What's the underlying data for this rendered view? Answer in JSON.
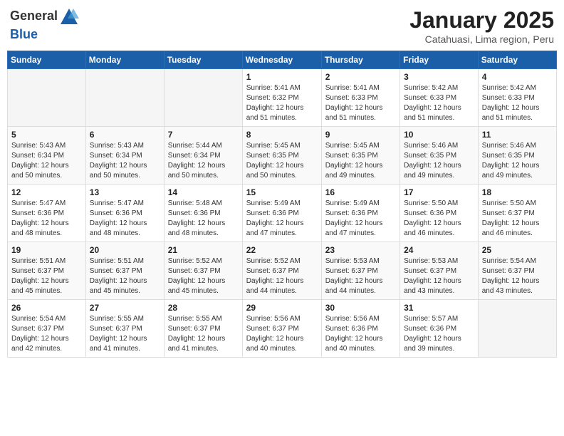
{
  "header": {
    "logo_general": "General",
    "logo_blue": "Blue",
    "month_title": "January 2025",
    "location": "Catahuasi, Lima region, Peru"
  },
  "days_of_week": [
    "Sunday",
    "Monday",
    "Tuesday",
    "Wednesday",
    "Thursday",
    "Friday",
    "Saturday"
  ],
  "weeks": [
    [
      {
        "day": "",
        "info": ""
      },
      {
        "day": "",
        "info": ""
      },
      {
        "day": "",
        "info": ""
      },
      {
        "day": "1",
        "info": "Sunrise: 5:41 AM\nSunset: 6:32 PM\nDaylight: 12 hours\nand 51 minutes."
      },
      {
        "day": "2",
        "info": "Sunrise: 5:41 AM\nSunset: 6:33 PM\nDaylight: 12 hours\nand 51 minutes."
      },
      {
        "day": "3",
        "info": "Sunrise: 5:42 AM\nSunset: 6:33 PM\nDaylight: 12 hours\nand 51 minutes."
      },
      {
        "day": "4",
        "info": "Sunrise: 5:42 AM\nSunset: 6:33 PM\nDaylight: 12 hours\nand 51 minutes."
      }
    ],
    [
      {
        "day": "5",
        "info": "Sunrise: 5:43 AM\nSunset: 6:34 PM\nDaylight: 12 hours\nand 50 minutes."
      },
      {
        "day": "6",
        "info": "Sunrise: 5:43 AM\nSunset: 6:34 PM\nDaylight: 12 hours\nand 50 minutes."
      },
      {
        "day": "7",
        "info": "Sunrise: 5:44 AM\nSunset: 6:34 PM\nDaylight: 12 hours\nand 50 minutes."
      },
      {
        "day": "8",
        "info": "Sunrise: 5:45 AM\nSunset: 6:35 PM\nDaylight: 12 hours\nand 50 minutes."
      },
      {
        "day": "9",
        "info": "Sunrise: 5:45 AM\nSunset: 6:35 PM\nDaylight: 12 hours\nand 49 minutes."
      },
      {
        "day": "10",
        "info": "Sunrise: 5:46 AM\nSunset: 6:35 PM\nDaylight: 12 hours\nand 49 minutes."
      },
      {
        "day": "11",
        "info": "Sunrise: 5:46 AM\nSunset: 6:35 PM\nDaylight: 12 hours\nand 49 minutes."
      }
    ],
    [
      {
        "day": "12",
        "info": "Sunrise: 5:47 AM\nSunset: 6:36 PM\nDaylight: 12 hours\nand 48 minutes."
      },
      {
        "day": "13",
        "info": "Sunrise: 5:47 AM\nSunset: 6:36 PM\nDaylight: 12 hours\nand 48 minutes."
      },
      {
        "day": "14",
        "info": "Sunrise: 5:48 AM\nSunset: 6:36 PM\nDaylight: 12 hours\nand 48 minutes."
      },
      {
        "day": "15",
        "info": "Sunrise: 5:49 AM\nSunset: 6:36 PM\nDaylight: 12 hours\nand 47 minutes."
      },
      {
        "day": "16",
        "info": "Sunrise: 5:49 AM\nSunset: 6:36 PM\nDaylight: 12 hours\nand 47 minutes."
      },
      {
        "day": "17",
        "info": "Sunrise: 5:50 AM\nSunset: 6:36 PM\nDaylight: 12 hours\nand 46 minutes."
      },
      {
        "day": "18",
        "info": "Sunrise: 5:50 AM\nSunset: 6:37 PM\nDaylight: 12 hours\nand 46 minutes."
      }
    ],
    [
      {
        "day": "19",
        "info": "Sunrise: 5:51 AM\nSunset: 6:37 PM\nDaylight: 12 hours\nand 45 minutes."
      },
      {
        "day": "20",
        "info": "Sunrise: 5:51 AM\nSunset: 6:37 PM\nDaylight: 12 hours\nand 45 minutes."
      },
      {
        "day": "21",
        "info": "Sunrise: 5:52 AM\nSunset: 6:37 PM\nDaylight: 12 hours\nand 45 minutes."
      },
      {
        "day": "22",
        "info": "Sunrise: 5:52 AM\nSunset: 6:37 PM\nDaylight: 12 hours\nand 44 minutes."
      },
      {
        "day": "23",
        "info": "Sunrise: 5:53 AM\nSunset: 6:37 PM\nDaylight: 12 hours\nand 44 minutes."
      },
      {
        "day": "24",
        "info": "Sunrise: 5:53 AM\nSunset: 6:37 PM\nDaylight: 12 hours\nand 43 minutes."
      },
      {
        "day": "25",
        "info": "Sunrise: 5:54 AM\nSunset: 6:37 PM\nDaylight: 12 hours\nand 43 minutes."
      }
    ],
    [
      {
        "day": "26",
        "info": "Sunrise: 5:54 AM\nSunset: 6:37 PM\nDaylight: 12 hours\nand 42 minutes."
      },
      {
        "day": "27",
        "info": "Sunrise: 5:55 AM\nSunset: 6:37 PM\nDaylight: 12 hours\nand 41 minutes."
      },
      {
        "day": "28",
        "info": "Sunrise: 5:55 AM\nSunset: 6:37 PM\nDaylight: 12 hours\nand 41 minutes."
      },
      {
        "day": "29",
        "info": "Sunrise: 5:56 AM\nSunset: 6:37 PM\nDaylight: 12 hours\nand 40 minutes."
      },
      {
        "day": "30",
        "info": "Sunrise: 5:56 AM\nSunset: 6:36 PM\nDaylight: 12 hours\nand 40 minutes."
      },
      {
        "day": "31",
        "info": "Sunrise: 5:57 AM\nSunset: 6:36 PM\nDaylight: 12 hours\nand 39 minutes."
      },
      {
        "day": "",
        "info": ""
      }
    ]
  ]
}
